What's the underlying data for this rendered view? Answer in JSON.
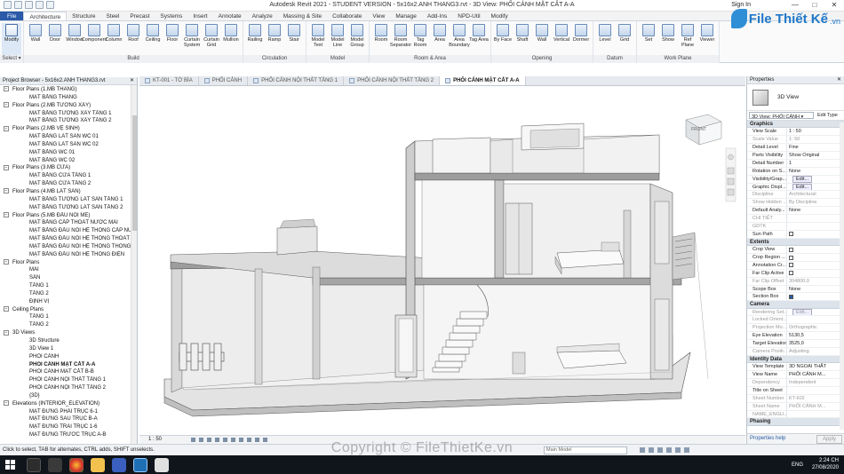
{
  "window": {
    "title": "Autodesk Revit 2021 - STUDENT VERSION - 5x16x2.ANH THANG3.rvt - 3D View: PHỐI CẢNH MẶT CẮT A-A",
    "signin": "Sign In",
    "minimize": "—",
    "maximize": "□",
    "close": "✕"
  },
  "logo": {
    "text": "File Thiết Kế",
    "domain": ".vn"
  },
  "ribbon_tabs": [
    "File",
    "Architecture",
    "Structure",
    "Steel",
    "Precast",
    "Systems",
    "Insert",
    "Annotate",
    "Analyze",
    "Massing & Site",
    "Collaborate",
    "View",
    "Manage",
    "Add-Ins",
    "NPD-Util",
    "Modify"
  ],
  "ribbon_groups": [
    {
      "label": "Select",
      "tools": [
        "Modify"
      ]
    },
    {
      "label": "Build",
      "tools": [
        "Wall",
        "Door",
        "Window",
        "Component",
        "Column",
        "Roof",
        "Ceiling",
        "Floor",
        "Curtain System",
        "Curtain Grid",
        "Mullion"
      ]
    },
    {
      "label": "Circulation",
      "tools": [
        "Railing",
        "Ramp",
        "Stair"
      ]
    },
    {
      "label": "Model",
      "tools": [
        "Model Text",
        "Model Line",
        "Model Group"
      ]
    },
    {
      "label": "Room & Area",
      "tools": [
        "Room",
        "Room Separator",
        "Tag Room",
        "Area",
        "Area Boundary",
        "Tag Area"
      ]
    },
    {
      "label": "Opening",
      "tools": [
        "By Face",
        "Shaft",
        "Wall",
        "Vertical",
        "Dormer"
      ]
    },
    {
      "label": "Datum",
      "tools": [
        "Level",
        "Grid"
      ]
    },
    {
      "label": "Work Plane",
      "tools": [
        "Set",
        "Show",
        "Ref Plane",
        "Viewer"
      ]
    }
  ],
  "select_menu": "Select ▾",
  "project_browser": {
    "title": "Project Browser - 5x16x2.ANH THANG3.rvt",
    "close": "✕",
    "items": [
      {
        "level": 0,
        "label": "Floor Plans (1.MB THANG)",
        "toggle": "−"
      },
      {
        "level": 1,
        "label": "MẶT BẰNG THANG"
      },
      {
        "level": 0,
        "label": "Floor Plans (2.MB TƯỜNG XÂY)",
        "toggle": "−"
      },
      {
        "level": 1,
        "label": "MẶT BẰNG TƯỜNG XÂY TẦNG 1"
      },
      {
        "level": 1,
        "label": "MẶT BẰNG TƯỜNG XÂY TẦNG 2"
      },
      {
        "level": 0,
        "label": "Floor Plans (2.MB VỆ SINH)",
        "toggle": "−"
      },
      {
        "level": 1,
        "label": "MẶT BẰNG LÁT SÀN WC 01"
      },
      {
        "level": 1,
        "label": "MẶT BẰNG LÁT SÀN WC 02"
      },
      {
        "level": 1,
        "label": "MẶT BẰNG WC 01"
      },
      {
        "level": 1,
        "label": "MẶT BẰNG WC 02"
      },
      {
        "level": 0,
        "label": "Floor Plans (3.MB CỬA)",
        "toggle": "−"
      },
      {
        "level": 1,
        "label": "MẶT BẰNG CỬA TẦNG 1"
      },
      {
        "level": 1,
        "label": "MẶT BẰNG CỬA TẦNG 2"
      },
      {
        "level": 0,
        "label": "Floor Plans (4.MB LÁT SÀN)",
        "toggle": "−"
      },
      {
        "level": 1,
        "label": "MẶT BẰNG TƯỜNG LÁT SÀN TẦNG 1"
      },
      {
        "level": 1,
        "label": "MẶT BẰNG TƯỜNG LÁT SÀN TẦNG 2"
      },
      {
        "level": 0,
        "label": "Floor Plans (5.MB ĐẤU NỐI ME)",
        "toggle": "−"
      },
      {
        "level": 1,
        "label": "MẶT BẰNG CẤP THOÁT NƯỚC MÁI"
      },
      {
        "level": 1,
        "label": "MẶT BẰNG ĐẤU NỐI HỆ THỐNG CẤP NƯỚC"
      },
      {
        "level": 1,
        "label": "MẶT BẰNG ĐẤU NỐI HỆ THỐNG THOÁT N"
      },
      {
        "level": 1,
        "label": "MẶT BẰNG ĐẤU NỐI HỆ THỐNG THÔNG T"
      },
      {
        "level": 1,
        "label": "MẶT BẰNG ĐẤU NỐI HỆ THỐNG ĐIỆN"
      },
      {
        "level": 0,
        "label": "Floor Plans",
        "toggle": "−"
      },
      {
        "level": 1,
        "label": "MÁI"
      },
      {
        "level": 1,
        "label": "SÂN"
      },
      {
        "level": 1,
        "label": "TẦNG 1"
      },
      {
        "level": 1,
        "label": "TẦNG 2"
      },
      {
        "level": 1,
        "label": "ĐỊNH VỊ"
      },
      {
        "level": 0,
        "label": "Ceiling Plans",
        "toggle": "−"
      },
      {
        "level": 1,
        "label": "TẦNG 1"
      },
      {
        "level": 1,
        "label": "TẦNG 2"
      },
      {
        "level": 0,
        "label": "3D Views",
        "toggle": "−"
      },
      {
        "level": 1,
        "label": "3D Structure"
      },
      {
        "level": 1,
        "label": "3D View 1"
      },
      {
        "level": 1,
        "label": "PHỐI CẢNH"
      },
      {
        "level": 1,
        "label": "PHỐI CẢNH MẶT CẮT A-A",
        "bold": true
      },
      {
        "level": 1,
        "label": "PHỐI CẢNH MẶT CẮT B-B"
      },
      {
        "level": 1,
        "label": "PHỐI CẢNH NỘI THẤT TẦNG 1"
      },
      {
        "level": 1,
        "label": "PHỐI CẢNH NỘI THẤT TẦNG 2"
      },
      {
        "level": 1,
        "label": "{3D}"
      },
      {
        "level": 0,
        "label": "Elevations (INTERIOR_ELEVATION)",
        "toggle": "−"
      },
      {
        "level": 1,
        "label": "MẶT ĐỨNG PHẢI TRỤC 6-1"
      },
      {
        "level": 1,
        "label": "MẶT ĐỨNG SAU TRỤC B-A"
      },
      {
        "level": 1,
        "label": "MẶT ĐỨNG TRÁI TRỤC 1-6"
      },
      {
        "level": 1,
        "label": "MẶT ĐỨNG TRƯỚC TRỤC A-B"
      }
    ]
  },
  "view_tabs": [
    {
      "label": "KT-001 - TỜ BÌA",
      "active": false
    },
    {
      "label": "PHỐI CẢNH",
      "active": false
    },
    {
      "label": "PHỐI CẢNH NỘI THẤT TẦNG 1",
      "active": false
    },
    {
      "label": "PHỐI CẢNH NỘI THẤT TẦNG 2",
      "active": false
    },
    {
      "label": "PHỐI CẢNH MẶT CẮT A-A",
      "active": true
    }
  ],
  "viewcube_label": "FRONT",
  "view_scale": "1 : 50",
  "properties": {
    "title": "Properties",
    "close": "✕",
    "type_name": "3D View",
    "view_selector": "3D View: PHỐI CẢNH ▾",
    "edit_type": "Edit Type",
    "help_link": "Properties help",
    "apply": "Apply",
    "sections": [
      {
        "name": "Graphics",
        "rows": [
          {
            "k": "View Scale",
            "v": "1 : 50"
          },
          {
            "k": "Scale Value",
            "v": "1:  50",
            "dim": true
          },
          {
            "k": "Detail Level",
            "v": "Fine"
          },
          {
            "k": "Parts Visibility",
            "v": "Show Original"
          },
          {
            "k": "Detail Number",
            "v": "1"
          },
          {
            "k": "Rotation on S...",
            "v": "None"
          },
          {
            "k": "Visibility/Grap...",
            "v": "",
            "btn": "Edit..."
          },
          {
            "k": "Graphic Displ...",
            "v": "",
            "btn": "Edit..."
          },
          {
            "k": "Discipline",
            "v": "Architectural",
            "dim": true
          },
          {
            "k": "Show Hidden ...",
            "v": "By Discipline",
            "dim": true
          },
          {
            "k": "Default Analy...",
            "v": "None"
          },
          {
            "k": "CHI TIẾT",
            "v": "",
            "dim": true
          },
          {
            "k": "GDTK",
            "v": "",
            "dim": true
          },
          {
            "k": "Sun Path",
            "v": "",
            "check": false
          }
        ]
      },
      {
        "name": "Extents",
        "rows": [
          {
            "k": "Crop View",
            "v": "",
            "check": false
          },
          {
            "k": "Crop Region ...",
            "v": "",
            "check": false
          },
          {
            "k": "Annotation Cr...",
            "v": "",
            "check": false
          },
          {
            "k": "Far Clip Active",
            "v": "",
            "check": false
          },
          {
            "k": "Far Clip Offset",
            "v": "304800,0",
            "dim": true
          },
          {
            "k": "Scope Box",
            "v": "None"
          },
          {
            "k": "Section Box",
            "v": "",
            "check": true
          }
        ]
      },
      {
        "name": "Camera",
        "rows": [
          {
            "k": "Rendering Set...",
            "v": "",
            "btn": "Edit...",
            "dim": true
          },
          {
            "k": "Locked Orient...",
            "v": "",
            "dim": true
          },
          {
            "k": "Projection Mo...",
            "v": "Orthographic",
            "dim": true
          },
          {
            "k": "Eye Elevation",
            "v": "5130,5"
          },
          {
            "k": "Target Elevation",
            "v": "3525,0"
          },
          {
            "k": "Camera Positi...",
            "v": "Adjusting",
            "dim": true
          }
        ]
      },
      {
        "name": "Identity Data",
        "rows": [
          {
            "k": "View Template",
            "v": "3D NGOẠI THẤT"
          },
          {
            "k": "View Name",
            "v": "PHỐI CẢNH M..."
          },
          {
            "k": "Dependency",
            "v": "Independent",
            "dim": true
          },
          {
            "k": "Title on Sheet",
            "v": ""
          },
          {
            "k": "Sheet Number",
            "v": "KT-602",
            "dim": true
          },
          {
            "k": "Sheet Name",
            "v": "PHỐI CẢNH M...",
            "dim": true
          },
          {
            "k": "NAME_ENGLI...",
            "v": "",
            "dim": true
          }
        ]
      },
      {
        "name": "Phasing",
        "rows": []
      }
    ]
  },
  "status": {
    "message": "Click to select, TAB for alternates, CTRL adds, SHIFT unselects.",
    "model": "Main Model",
    "zero": ":0"
  },
  "watermark": "Copyright © FileThietKe.vn",
  "taskbar": {
    "time": "2:24 CH",
    "date": "27/08/2020",
    "lang": "ENG"
  }
}
